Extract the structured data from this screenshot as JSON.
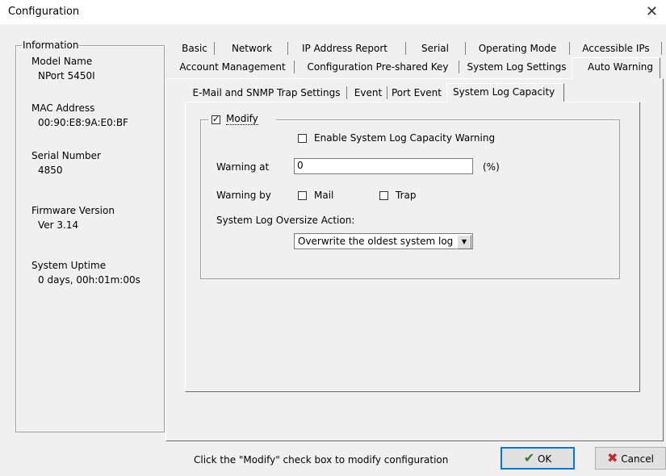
{
  "window": {
    "title": "Configuration",
    "close_glyph": "✕"
  },
  "info": {
    "legend": "Information",
    "model_label": "Model Name",
    "model_value": "NPort 5450I",
    "mac_label": "MAC Address",
    "mac_value": "00:90:E8:9A:E0:BF",
    "serial_label": "Serial Number",
    "serial_value": "4850",
    "fw_label": "Firmware Version",
    "fw_value": "Ver 3.14",
    "uptime_label": "System Uptime",
    "uptime_value": "0 days, 00h:01m:00s"
  },
  "tabs_row1": [
    "Basic",
    "Network",
    "IP Address Report",
    "Serial",
    "Operating Mode",
    "Accessible IPs"
  ],
  "tabs_row2": [
    "Account Management",
    "Configuration Pre-shared Key",
    "System Log Settings",
    "Auto Warning"
  ],
  "subtabs": [
    "E-Mail and SNMP Trap Settings",
    "Event",
    "Port Event",
    "System Log Capacity"
  ],
  "form": {
    "modify_label": "Modify",
    "enable_label": "Enable System Log Capacity Warning",
    "warning_at_label": "Warning at",
    "warning_at_value": "0",
    "percent_label": "(%)",
    "warning_by_label": "Warning by",
    "mail_label": "Mail",
    "trap_label": "Trap",
    "oversize_label": "System Log Oversize Action:",
    "oversize_value": "Overwrite the oldest system log"
  },
  "footer": {
    "hint": "Click the \"Modify\" check box to modify configuration",
    "ok_label": "OK",
    "cancel_label": "Cancel",
    "ok_color": "#2e7d32",
    "cancel_color": "#c62828"
  }
}
